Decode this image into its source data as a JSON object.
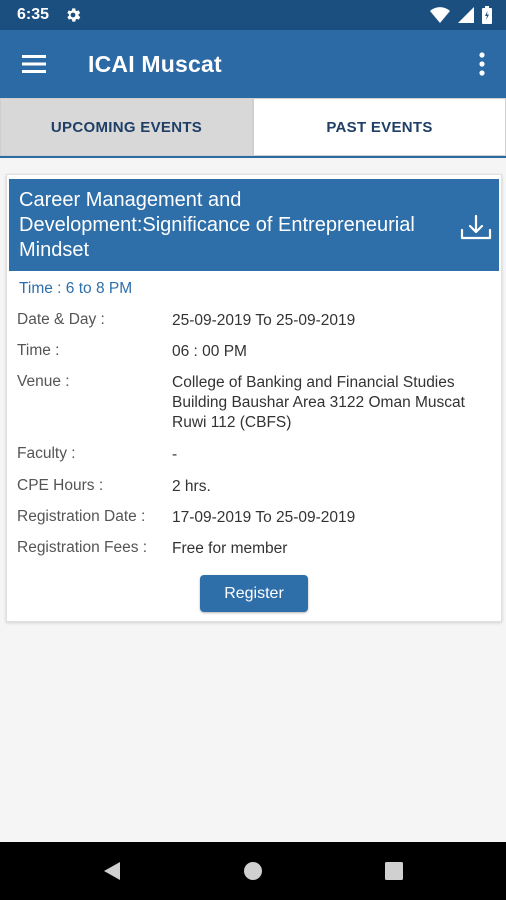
{
  "status_bar": {
    "time": "6:35",
    "icons": [
      "settings-icon",
      "wifi-icon",
      "signal-icon",
      "battery-icon"
    ]
  },
  "app_bar": {
    "title": "ICAI Muscat",
    "color": "#2b6aa5"
  },
  "tabs": [
    {
      "label": "UPCOMING EVENTS",
      "active": true
    },
    {
      "label": "PAST EVENTS",
      "active": false
    }
  ],
  "event": {
    "title": "Career Management and Development:Significance of Entrepreneurial Mindset",
    "time_summary": "Time : 6 to 8 PM",
    "details": [
      {
        "label": "Date & Day :",
        "value": "25-09-2019 To 25-09-2019"
      },
      {
        "label": "Time :",
        "value": "06 : 00 PM"
      },
      {
        "label": "Venue :",
        "value": "College of Banking and Financial Studies Building Baushar Area 3122 Oman Muscat Ruwi 112 (CBFS)"
      },
      {
        "label": "Faculty :",
        "value": "-"
      },
      {
        "label": "CPE Hours :",
        "value": "2 hrs."
      },
      {
        "label": "Registration Date :",
        "value": "17-09-2019 To 25-09-2019"
      },
      {
        "label": "Registration Fees :",
        "value": "Free for member"
      }
    ],
    "register_label": "Register"
  },
  "nav_bar": {
    "buttons": [
      "back-icon",
      "home-icon",
      "recents-icon"
    ]
  }
}
